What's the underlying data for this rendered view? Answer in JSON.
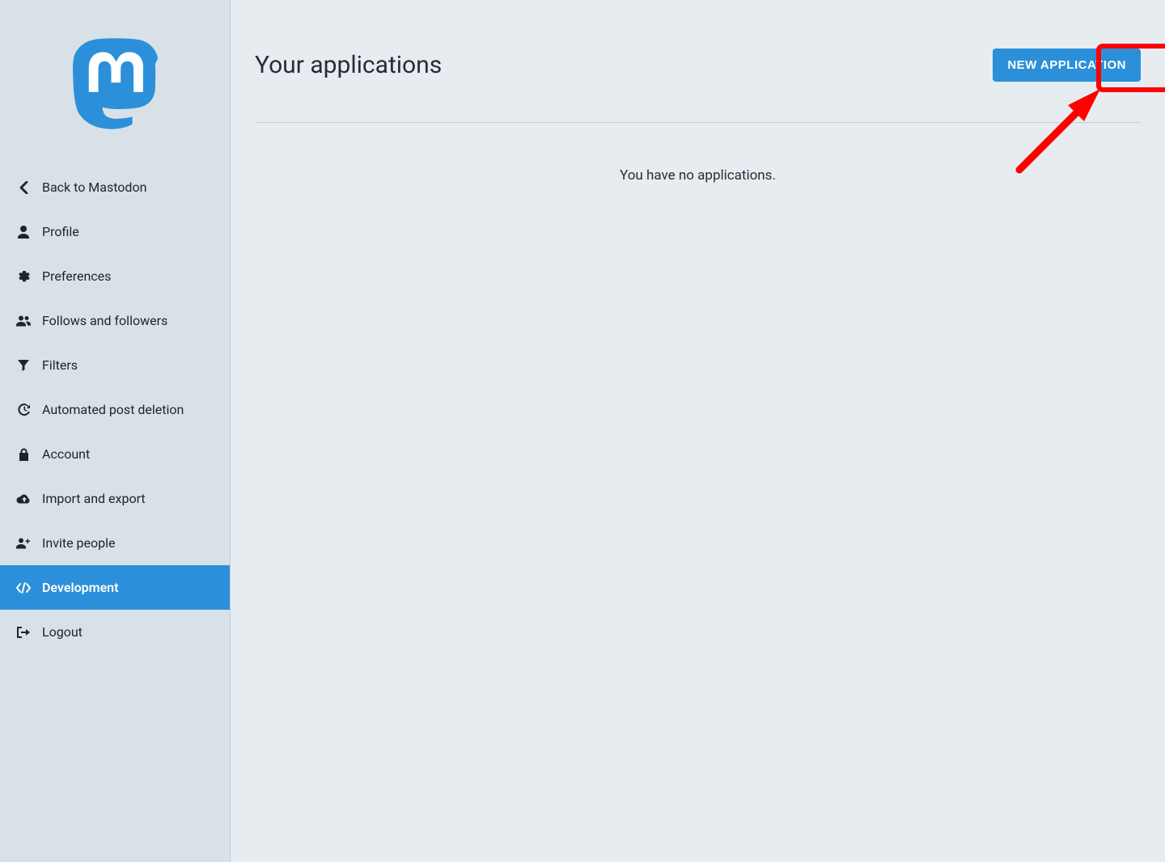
{
  "sidebar": {
    "items": [
      {
        "label": "Back to Mastodon",
        "icon": "chevron-left-icon",
        "active": false
      },
      {
        "label": "Profile",
        "icon": "user-icon",
        "active": false
      },
      {
        "label": "Preferences",
        "icon": "gear-icon",
        "active": false
      },
      {
        "label": "Follows and followers",
        "icon": "users-icon",
        "active": false
      },
      {
        "label": "Filters",
        "icon": "filter-icon",
        "active": false
      },
      {
        "label": "Automated post deletion",
        "icon": "history-icon",
        "active": false
      },
      {
        "label": "Account",
        "icon": "lock-icon",
        "active": false
      },
      {
        "label": "Import and export",
        "icon": "cloud-icon",
        "active": false
      },
      {
        "label": "Invite people",
        "icon": "user-plus-icon",
        "active": false
      },
      {
        "label": "Development",
        "icon": "code-icon",
        "active": true
      },
      {
        "label": "Logout",
        "icon": "signout-icon",
        "active": false
      }
    ]
  },
  "main": {
    "title": "Your applications",
    "new_app_button": "NEW APPLICATION",
    "empty_message": "You have no applications."
  },
  "colors": {
    "accent": "#2b90d9",
    "annotation": "#ff0000"
  }
}
